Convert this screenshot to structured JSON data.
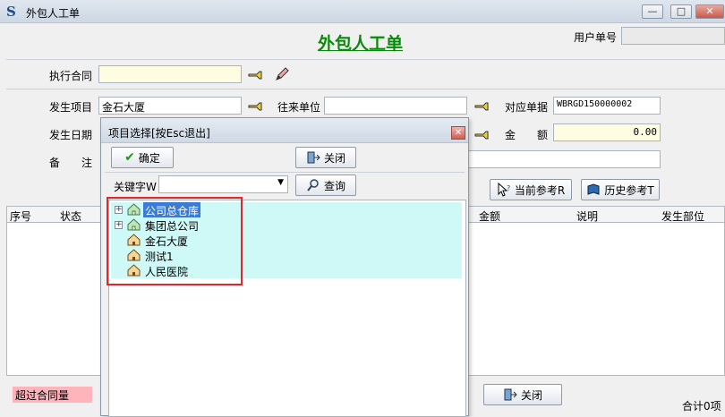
{
  "window": {
    "title": "外包人工单",
    "minimize": "—",
    "maximize": "□",
    "close": "✕"
  },
  "form": {
    "title": "外包人工单",
    "user_no_label": "用户单号",
    "user_no_value": "",
    "contract_label": "执行合同",
    "contract_value": "",
    "project_label": "发生项目",
    "project_value": "金石大厦",
    "vendor_label": "往来单位",
    "vendor_value": "",
    "doc_label": "对应单据",
    "doc_value": "WBRGD150000002",
    "date_label": "发生日期",
    "amount_label": "金　　额",
    "amount_value": "0.00",
    "remark_label": "备　　注",
    "remark_value": "",
    "current_ref_button": "当前参考R",
    "history_ref_button": "历史参考T",
    "close_button": "关闭",
    "over_contract": "超过合同量",
    "total_text": "合计0项"
  },
  "grid": {
    "columns": [
      "序号",
      "状态",
      "金额",
      "说明",
      "发生部位"
    ]
  },
  "dialog": {
    "title": "项目选择[按Esc退出]",
    "ok_button": "确定",
    "close_button": "关闭",
    "keyword_label": "关键字W",
    "keyword_value": "",
    "search_button": "查询",
    "tree_items": [
      {
        "label": "公司总仓库",
        "expandable": true,
        "selected": true
      },
      {
        "label": "集团总公司",
        "expandable": true,
        "selected": false
      },
      {
        "label": "金石大厦",
        "expandable": false,
        "selected": false
      },
      {
        "label": "测试1",
        "expandable": false,
        "selected": false
      },
      {
        "label": "人民医院",
        "expandable": false,
        "selected": false
      }
    ]
  },
  "colors": {
    "title_green": "#0a8a0a",
    "selection": "#3a7bd5",
    "tree_bg": "#cff9f7",
    "highlight_box": "#e0282c",
    "over_contract_bg": "#ffb3ba"
  }
}
